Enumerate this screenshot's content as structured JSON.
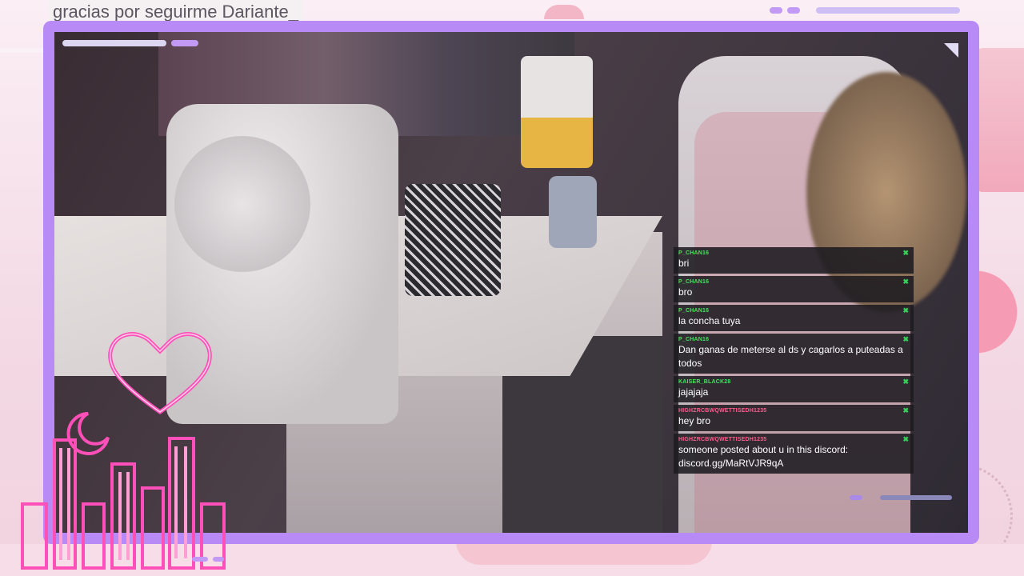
{
  "banner": {
    "text": "gracias por seguirme Dariante_"
  },
  "colors": {
    "frame": "#b88af5",
    "accent_bar": "#c9b7f3",
    "neon_pink": "#ff4fb8",
    "chat_bg": "#1c1a20",
    "green_user": "#44e35b",
    "pink_user": "#ff5b8e",
    "dismiss_green": "#35d05a"
  },
  "chat": {
    "messages": [
      {
        "user": "P_CHAN16",
        "user_color": "green",
        "text": "bri"
      },
      {
        "user": "P_CHAN16",
        "user_color": "green",
        "text": "bro"
      },
      {
        "user": "P_CHAN16",
        "user_color": "green",
        "text": "la concha tuya"
      },
      {
        "user": "P_CHAN16",
        "user_color": "green",
        "text": "Dan ganas de meterse al ds y cagarlos a puteadas a todos"
      },
      {
        "user": "KAISER_BLACK28",
        "user_color": "green",
        "text": "jajajaja"
      },
      {
        "user": "HIGHZRCBWQWETTISEDH1235",
        "user_color": "pink",
        "text": "hey bro"
      },
      {
        "user": "HIGHZRCBWQWETTISEDH1235",
        "user_color": "pink",
        "text": "someone posted about u in this discord: discord.gg/MaRtVJR9qA"
      }
    ],
    "dismiss_icon": "close-icon"
  },
  "decor": {
    "icons": [
      "heart-icon",
      "moon-icon",
      "city-skyline-icon"
    ]
  }
}
